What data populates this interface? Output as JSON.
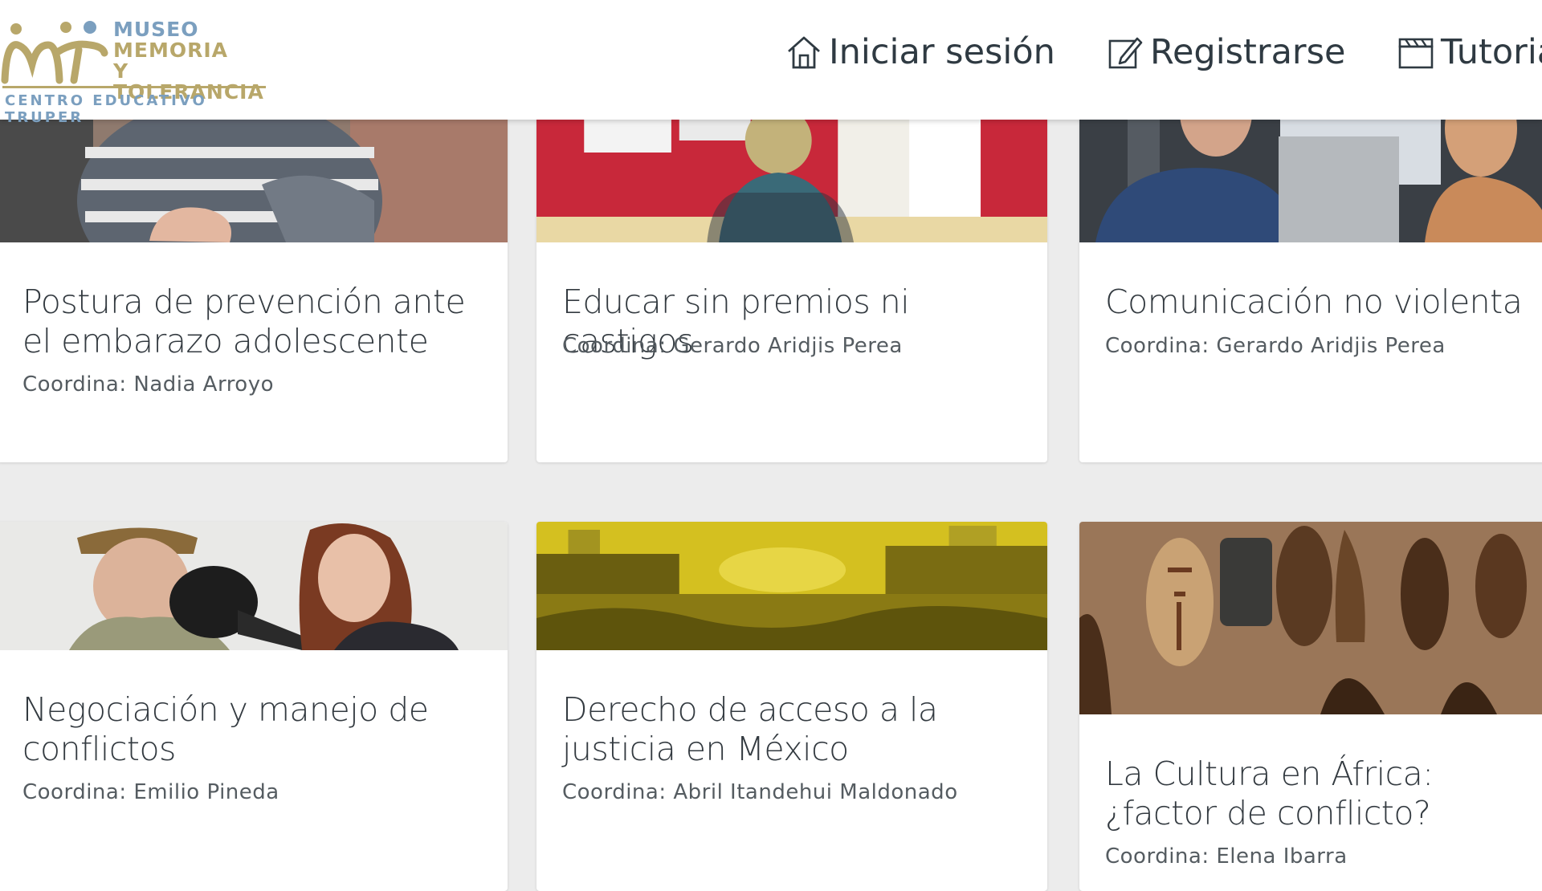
{
  "header": {
    "logo": {
      "line1": "MUSEO",
      "line2": "MEMORIA",
      "line3": "Y TOLERANCIA",
      "subtitle": "CENTRO EDUCATIVO TRUPER"
    },
    "nav": [
      {
        "label": "Iniciar sesión",
        "icon": "home-icon"
      },
      {
        "label": "Registrarse",
        "icon": "edit-icon"
      },
      {
        "label": "Tutoria",
        "icon": "clapperboard-icon"
      }
    ]
  },
  "courses": [
    {
      "title": "Postura de prevención ante el embarazo adolescente",
      "coordinator": "Coordina: Nadia Arroyo"
    },
    {
      "title": "Educar sin premios ni castigos",
      "coordinator": "Coordina: Gerardo Aridjis Perea"
    },
    {
      "title": "Comunicación no violenta",
      "coordinator": "Coordina: Gerardo Aridjis Perea"
    },
    {
      "title": "Negociación y manejo de conflictos",
      "coordinator": "Coordina: Emilio Pineda"
    },
    {
      "title": "Derecho de acceso a la justicia en México",
      "coordinator": "Coordina: Abril Itandehui Maldonado"
    },
    {
      "title": "La Cultura en África: ¿factor de conflicto?",
      "coordinator": "Coordina: Elena Ibarra"
    }
  ],
  "colors": {
    "logo_blue": "#7b9fbf",
    "logo_gold": "#b8a76a",
    "nav_text": "#2f3a42",
    "page_bg": "#ececec"
  }
}
